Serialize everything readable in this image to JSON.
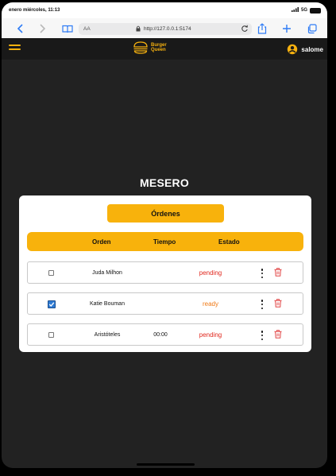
{
  "status": {
    "time": "enero miércoles, 11:13",
    "network": "5G"
  },
  "browser": {
    "aa": "AA",
    "url": "http://127.0.0.1:5174"
  },
  "nav": {
    "logo_line1": "Burger",
    "logo_line2": "Queen",
    "username": "salome"
  },
  "page": {
    "title": "MESERO",
    "orders_button": "Órdenes"
  },
  "table": {
    "headers": {
      "order": "Orden",
      "time": "Tiempo",
      "state": "Estado"
    },
    "rows": [
      {
        "name": "Juda Milhon",
        "time": "",
        "state": "pending",
        "checked": false
      },
      {
        "name": "Katie Bouman",
        "time": "",
        "state": "ready",
        "checked": true
      },
      {
        "name": "Aristóteles",
        "time": "00:00",
        "state": "pending",
        "checked": false
      }
    ]
  },
  "colors": {
    "accent": "#f8b20c",
    "pending": "#e0261c",
    "ready": "#f07a16",
    "background": "#222222"
  }
}
